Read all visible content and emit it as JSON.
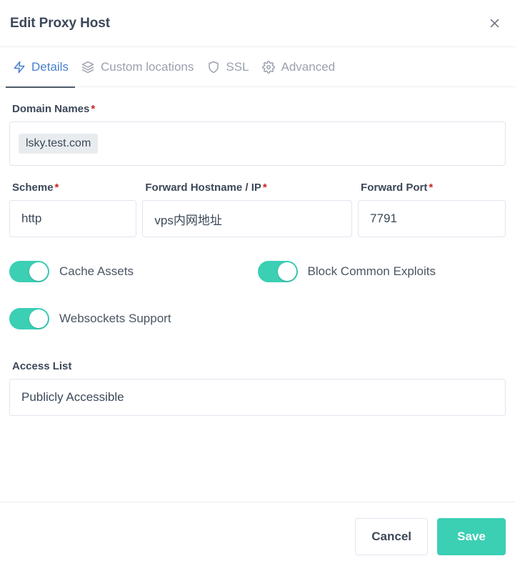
{
  "colors": {
    "accent_teal": "#3bcfb4",
    "tab_active_blue": "#467fcf",
    "tab_inactive": "#9aa0ae",
    "required_red": "#cd201f",
    "text_dark": "#3c4858",
    "border": "#e1e5ef",
    "token_bg": "#e9ecef"
  },
  "header": {
    "title": "Edit Proxy Host",
    "close_icon": "close-icon",
    "close_label": "×"
  },
  "tabs": [
    {
      "label": "Details",
      "icon": "zap-icon",
      "active": true
    },
    {
      "label": "Custom locations",
      "icon": "layers-icon",
      "active": false
    },
    {
      "label": "SSL",
      "icon": "shield-icon",
      "active": false
    },
    {
      "label": "Advanced",
      "icon": "gear-icon",
      "active": false
    }
  ],
  "form": {
    "domain_names": {
      "label": "Domain Names",
      "required_marker": "*",
      "tokens": [
        "lsky.test.com"
      ],
      "placeholder": ""
    },
    "scheme": {
      "label": "Scheme",
      "required_marker": "*",
      "value": "http",
      "placeholder": "http"
    },
    "forward_hostname": {
      "label": "Forward Hostname / IP",
      "required_marker": "*",
      "value": "vps内网地址",
      "placeholder": ""
    },
    "forward_port": {
      "label": "Forward Port",
      "required_marker": "*",
      "value": "7791",
      "placeholder": ""
    },
    "toggles": [
      {
        "label": "Cache Assets",
        "on": true
      },
      {
        "label": "Block Common Exploits",
        "on": true
      },
      {
        "label": "Websockets Support",
        "on": true
      }
    ],
    "access_list": {
      "label": "Access List",
      "value": "Publicly Accessible",
      "placeholder": ""
    }
  },
  "footer": {
    "cancel_label": "Cancel",
    "save_label": "Save"
  }
}
